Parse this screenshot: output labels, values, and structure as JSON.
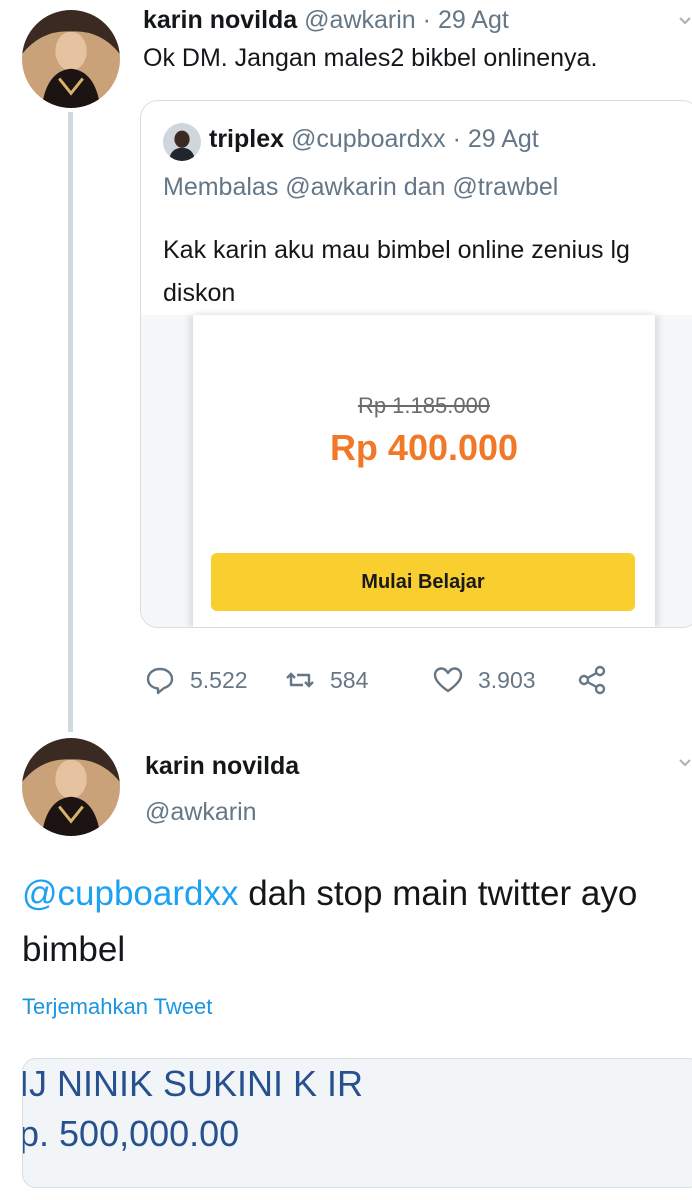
{
  "tweet1": {
    "name": "karin novilda",
    "handle": "@awkarin",
    "separator": "·",
    "date": "29 Agt",
    "text": "Ok DM. Jangan males2 bikbel onlinenya."
  },
  "quoted": {
    "name": "triplex",
    "handle": "@cupboardxx",
    "separator": "·",
    "date": "29 Agt",
    "reply_to": "Membalas @awkarin dan @trawbel",
    "text": "Kak karin aku mau bimbel online zenius lg diskon",
    "card": {
      "old_price": "Rp 1.185.000",
      "new_price": "Rp 400.000",
      "button_label": "Mulai Belajar"
    }
  },
  "actions": {
    "replies": "5.522",
    "retweets": "584",
    "likes": "3.903"
  },
  "tweet2": {
    "name": "karin novilda",
    "handle": "@awkarin",
    "mention": "@cupboardxx",
    "text": " dah stop main twitter ayo bimbel",
    "translate_label": "Terjemahkan Tweet",
    "media": {
      "line1": "IJ NINIK SUKINI K IR",
      "line2": "p. 500,000.00"
    }
  },
  "colors": {
    "link": "#1da1f2",
    "muted": "#657786",
    "price_accent": "#f07826",
    "cta_bg": "#f9cf2f",
    "thread_line": "#cfd9de"
  },
  "icons": [
    "reply-icon",
    "retweet-icon",
    "like-icon",
    "share-icon",
    "chevron-down-icon"
  ]
}
